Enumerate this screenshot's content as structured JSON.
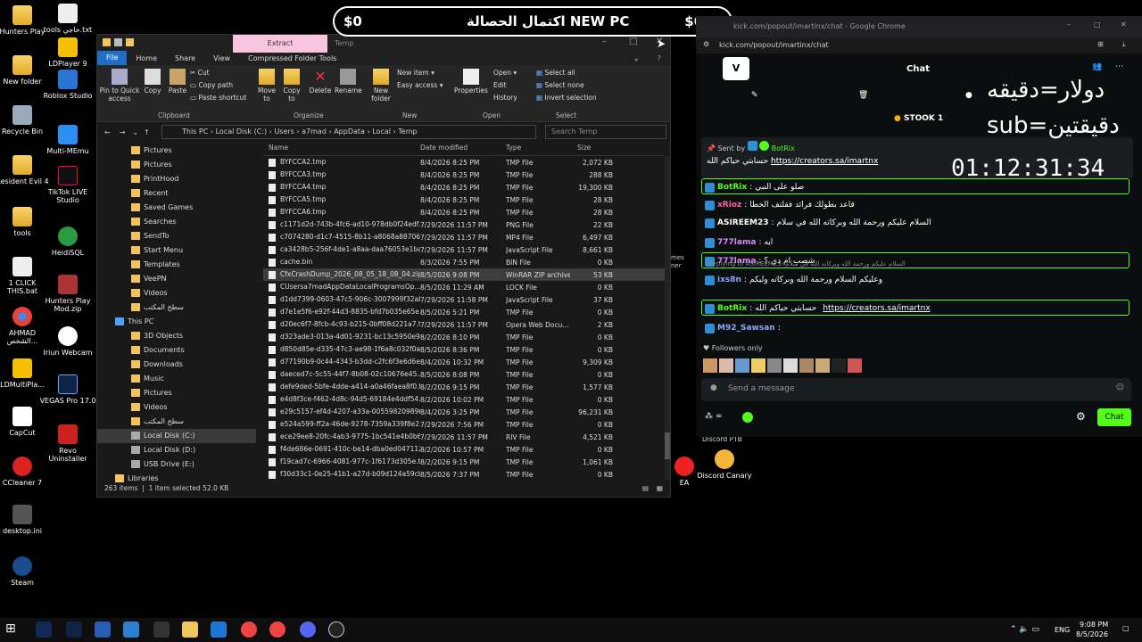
{
  "banner": {
    "left": "$0",
    "center": "اكتمال الحصالة NEW PC",
    "right": "$650"
  },
  "desktop_icons": [
    {
      "label": "Hunters Play",
      "icon": "folder"
    },
    {
      "label": "New folder",
      "icon": "folder"
    },
    {
      "label": "Recycle Bin",
      "icon": "recycle-bin"
    },
    {
      "label": "Resident Evil 4",
      "icon": "folder"
    },
    {
      "label": "tools",
      "icon": "folder"
    },
    {
      "label": "1 CLICK THIS.bat",
      "icon": "bat-file"
    },
    {
      "label": "AHMAD الشخص...",
      "icon": "chrome"
    },
    {
      "label": "LDMultiPla...",
      "icon": "ldmultiplayer"
    },
    {
      "label": "CapCut",
      "icon": "capcut"
    },
    {
      "label": "CCleaner 7",
      "icon": "ccleaner"
    },
    {
      "label": "desktop.ini",
      "icon": "ini-file"
    },
    {
      "label": "Steam",
      "icon": "steam"
    },
    {
      "label": "tools حاجي.txt",
      "icon": "text-file"
    },
    {
      "label": "LDPlayer 9",
      "icon": "ldplayer"
    },
    {
      "label": "Roblox Studio",
      "icon": "roblox"
    },
    {
      "label": "Multi-MEmu",
      "icon": "memu"
    },
    {
      "label": "TikTok LIVE Studio",
      "icon": "tiktok"
    },
    {
      "label": "HeidiSQL",
      "icon": "heidisql"
    },
    {
      "label": "Hunters Play Mod.zip",
      "icon": "zip"
    },
    {
      "label": "Iriun Webcam",
      "icon": "webcam"
    },
    {
      "label": "VEGAS Pro 17.0",
      "icon": "vegas"
    },
    {
      "label": "Revo Uninstaller",
      "icon": "revo"
    },
    {
      "label": "EA",
      "icon": "ea"
    },
    {
      "label": "Discord Canary",
      "icon": "discord"
    },
    {
      "label": "Discord PTB",
      "icon": "discord"
    }
  ],
  "explorer": {
    "context_tab": "Extract",
    "context_title": "Temp",
    "tabs": [
      "File",
      "Home",
      "Share",
      "View",
      "Compressed Folder Tools"
    ],
    "ribbon": {
      "pin": "Pin to Quick access",
      "copy": "Copy",
      "paste": "Paste",
      "cut": "Cut",
      "copy_path": "Copy path",
      "paste_shortcut": "Paste shortcut",
      "move_to": "Move to",
      "copy_to": "Copy to",
      "delete": "Delete",
      "rename": "Rename",
      "new_folder": "New folder",
      "new_item": "New item",
      "easy_access": "Easy access",
      "properties": "Properties",
      "open": "Open",
      "edit": "Edit",
      "history": "History",
      "select_all": "Select all",
      "select_none": "Select none",
      "invert": "Invert selection",
      "groups": [
        "Clipboard",
        "Organize",
        "New",
        "Open",
        "Select"
      ]
    },
    "breadcrumb": [
      "This PC",
      "Local Disk (C:)",
      "Users",
      "a7mad",
      "AppData",
      "Local",
      "Temp"
    ],
    "search_placeholder": "Search Temp",
    "nav": [
      "Pictures",
      "Pictures",
      "PrintHood",
      "Recent",
      "Saved Games",
      "Searches",
      "SendTo",
      "Start Menu",
      "Templates",
      "VeePN",
      "Videos",
      "سطح المكتب",
      "This PC",
      "3D Objects",
      "Documents",
      "Downloads",
      "Music",
      "Pictures",
      "Videos",
      "سطح المكتب",
      "Local Disk (C:)",
      "Local Disk (D:)",
      "USB Drive (E:)",
      "Libraries"
    ],
    "columns": [
      "Name",
      "Date modified",
      "Type",
      "Size"
    ],
    "files": [
      [
        "BYFCCA2.tmp",
        "8/4/2026 8:25 PM",
        "TMP File",
        "2,072 KB"
      ],
      [
        "BYFCCA3.tmp",
        "8/4/2026 8:25 PM",
        "TMP File",
        "288 KB"
      ],
      [
        "BYFCCA4.tmp",
        "8/4/2026 8:25 PM",
        "TMP File",
        "19,300 KB"
      ],
      [
        "BYFCCA5.tmp",
        "8/4/2026 8:25 PM",
        "TMP File",
        "28 KB"
      ],
      [
        "BYFCCA6.tmp",
        "8/4/2026 8:25 PM",
        "TMP File",
        "28 KB"
      ],
      [
        "c1171d2d-743b-4fc6-ad10-978db0f24edf...",
        "7/29/2026 11:57 PM",
        "PNG File",
        "22 KB"
      ],
      [
        "c7074280-d1c7-4515-8b11-a8068a88706...",
        "7/29/2026 11:57 PM",
        "MP4 File",
        "6,497 KB"
      ],
      [
        "ca3428b5-256f-4de1-a8aa-daa76053e1ba...",
        "7/29/2026 11:57 PM",
        "JavaScript File",
        "8,661 KB"
      ],
      [
        "cache.bin",
        "8/3/2026 7:55 PM",
        "BIN File",
        "0 KB"
      ],
      [
        "CfxCrashDump_2026_08_05_18_08_04.zip",
        "8/5/2026 9:08 PM",
        "WinRAR ZIP archive",
        "53 KB"
      ],
      [
        "CUsersa7madAppDataLocalProgramsOp...",
        "8/5/2026 11:29 AM",
        "LOCK File",
        "0 KB"
      ],
      [
        "d1dd7399-0603-47c5-906c-3007999f32ab...",
        "7/29/2026 11:58 PM",
        "JavaScript File",
        "37 KB"
      ],
      [
        "d7e1e5f6-e92f-44d3-8835-bfd7b035e65e...",
        "8/5/2026 5:21 PM",
        "TMP File",
        "0 KB"
      ],
      [
        "d20ec6f7-8fcb-4c93-b215-0bff08d221a7.t...",
        "7/29/2026 11:57 PM",
        "Opera Web Docu...",
        "2 KB"
      ],
      [
        "d323ade3-013a-4d01-9231-bc13c5950e9e...",
        "8/2/2026 8:10 PM",
        "TMP File",
        "0 KB"
      ],
      [
        "d850d85e-d335-47c3-ae98-1f6a8c032f0a...",
        "8/5/2026 8:36 PM",
        "TMP File",
        "0 KB"
      ],
      [
        "d77190b9-0c44-4343-b3dd-c2fc6f3e6d6e...",
        "8/4/2026 10:32 PM",
        "TMP File",
        "9,309 KB"
      ],
      [
        "daeced7c-5c55-44f7-8b08-02c10676e45...",
        "8/5/2026 8:08 PM",
        "TMP File",
        "0 KB"
      ],
      [
        "defe9ded-5bfe-4dde-a414-a0a46faea8f0.t...",
        "8/2/2026 9:15 PM",
        "TMP File",
        "1,577 KB"
      ],
      [
        "e4d8f3ce-f462-4d8c-94d5-69184e4ddf54...",
        "8/2/2026 10:02 PM",
        "TMP File",
        "0 KB"
      ],
      [
        "e29c5157-ef4d-4207-a33a-005598209896...",
        "8/4/2026 3:25 PM",
        "TMP File",
        "96,231 KB"
      ],
      [
        "e524a599-ff2a-46de-9278-7359a339f8e2.t...",
        "7/29/2026 7:56 PM",
        "TMP File",
        "0 KB"
      ],
      [
        "ece29ee8-20fc-4ab3-9775-1bc541e4b0b6...",
        "7/29/2026 11:57 PM",
        "RIV File",
        "4,521 KB"
      ],
      [
        "f4de686e-0691-410c-be14-dba0ed047112...",
        "8/2/2026 10:57 PM",
        "TMP File",
        "0 KB"
      ],
      [
        "f19cad7c-6966-4081-977c-1f6173d305e.t...",
        "8/2/2026 9:15 PM",
        "TMP File",
        "1,061 KB"
      ],
      [
        "f30d33c1-0e25-41b1-a27d-b09d124a59cb...",
        "8/5/2026 7:37 PM",
        "TMP File",
        "0 KB"
      ]
    ],
    "selected_index": 9,
    "status_count": "263 items",
    "status_selected": "1 item selected  52.0 KB"
  },
  "browser": {
    "title": "kick.com/popout/imartinx/chat - Google Chrome",
    "url": "kick.com/popout/imartinx/chat"
  },
  "chat": {
    "header": "Chat",
    "pinned_stock": "STOOK 1",
    "pinned_sent_by": "Sent by",
    "pinned_user": "BotRix",
    "pinned_text": "حسابتي حياكم الله",
    "pinned_link": "https://creators.sa/imartnx",
    "overlay_line1": "دولار=دقيقه",
    "overlay_line2": "sub=دقيقتين",
    "timer": "01:12:31:34",
    "messages": [
      {
        "user": "BotRix",
        "text": "صلو على النبي",
        "user_color": "#53fc18",
        "highlight": true
      },
      {
        "user": "xRioz",
        "text": "قاعد بطولك فرائد فقلتف الخطا",
        "user_color": "#ff5fa8",
        "highlight": false
      },
      {
        "user": "ASIREEM23",
        "text": "السلام عليكم ورحمة الله وبركاته الله في سلام",
        "user_color": "#ffffff",
        "highlight": false
      },
      {
        "user": "777lama",
        "text": "ايه",
        "user_color": "#cf8bff",
        "highlight": false
      },
      {
        "user": "777lama",
        "text": "شصب ام دي ؟",
        "user_color": "#cf8bff",
        "highlight": true
      },
      {
        "user": "ixs8n",
        "text": "وعليكم السلام ورحمة الله وبركاته وليكم",
        "user_color": "#8aa8ff",
        "highlight": false,
        "reply": "Replying to ASIREEM23: السلام عليكم ورحمة الله وبركاته الله في سلام"
      },
      {
        "user": "BotRix",
        "text": "حسابتي حياكم الله",
        "link": "https://creators.sa/imartnx",
        "user_color": "#53fc18",
        "highlight": true
      },
      {
        "user": "M92_Sawsan",
        "text": "",
        "user_color": "#8aa8ff",
        "highlight": false
      }
    ],
    "followers_only": "Followers only",
    "input_placeholder": "Send a message",
    "send_button": "Chat"
  },
  "partial_bg_text": "mes\nner",
  "taskbar": {
    "lang": "ENG",
    "time": "9:08 PM",
    "date": "8/5/2026"
  },
  "colors": {
    "kick_green": "#53fc18",
    "explorer_bg": "#191919",
    "ribbon_context": "#f9c4e0"
  }
}
